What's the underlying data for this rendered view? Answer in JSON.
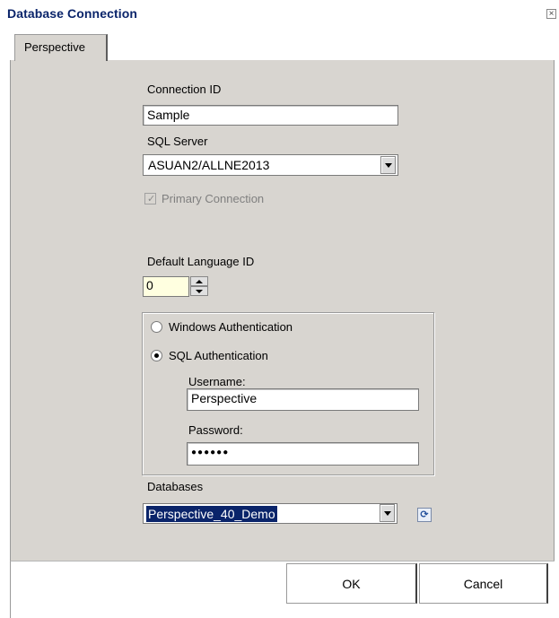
{
  "window": {
    "title": "Database Connection",
    "close_glyph": "×"
  },
  "tabs": [
    {
      "label": "Perspective",
      "selected": true
    }
  ],
  "form": {
    "connection_id": {
      "label": "Connection ID",
      "value": "Sample"
    },
    "sql_server": {
      "label": "SQL Server",
      "value": "ASUAN2/ALLNE2013"
    },
    "primary_connection": {
      "label": "Primary Connection",
      "checked": true,
      "enabled": false
    },
    "default_language": {
      "label": "Default Language ID",
      "value": "0"
    },
    "auth": {
      "windows_label": "Windows Authentication",
      "sql_label": "SQL Authentication",
      "selected": "sql",
      "username_label": "Username:",
      "username_value": "Perspective",
      "password_label": "Password:",
      "password_value": "●●●●●●"
    },
    "databases": {
      "label": "Databases",
      "value": "Perspective_40_Demo",
      "refresh_icon": "refresh-icon"
    }
  },
  "buttons": {
    "ok": "OK",
    "cancel": "Cancel"
  },
  "colors": {
    "panel": "#d8d5d0",
    "title_text": "#0a246a",
    "selection": "#0a246a",
    "spin_bg": "#ffffe0"
  }
}
